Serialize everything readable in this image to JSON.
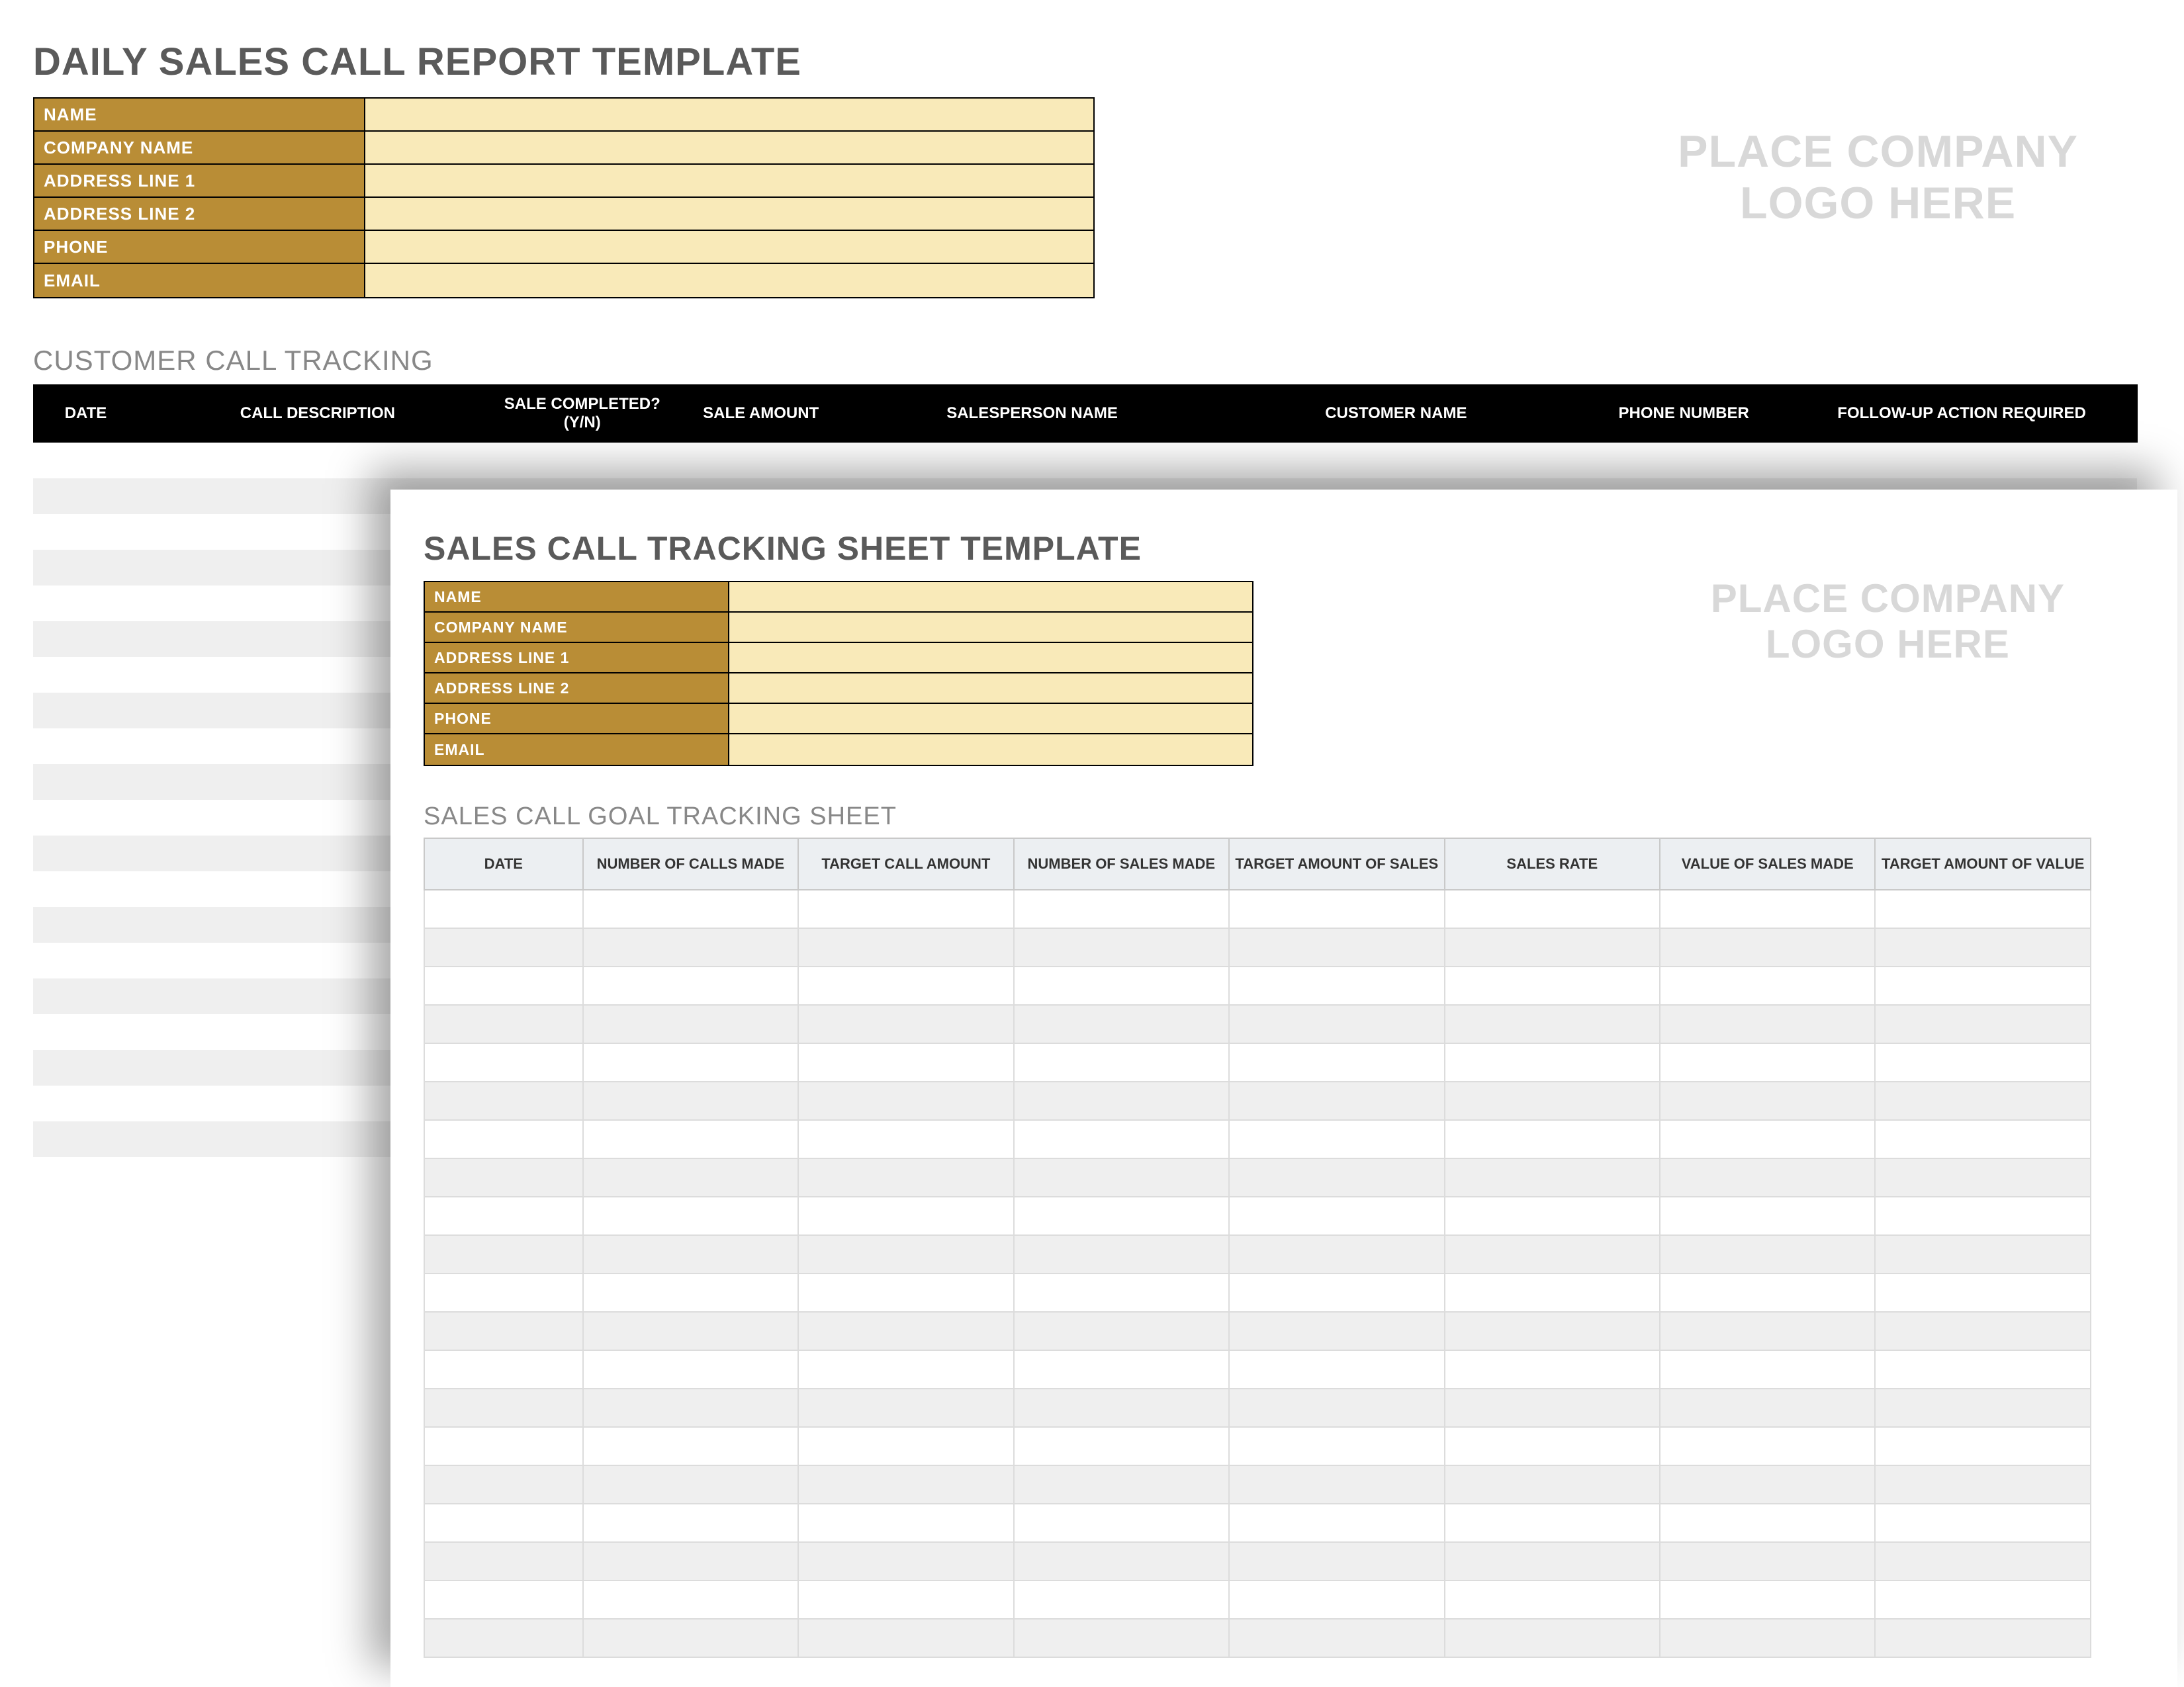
{
  "back": {
    "title": "DAILY SALES CALL REPORT TEMPLATE",
    "info": {
      "name_label": "NAME",
      "company_label": "COMPANY NAME",
      "addr1_label": "ADDRESS LINE 1",
      "addr2_label": "ADDRESS LINE 2",
      "phone_label": "PHONE",
      "email_label": "EMAIL",
      "name": "",
      "company": "",
      "addr1": "",
      "addr2": "",
      "phone": "",
      "email": ""
    },
    "logo_line1": "PLACE COMPANY",
    "logo_line2": "LOGO HERE",
    "section": "CUSTOMER CALL TRACKING",
    "columns": {
      "date": "DATE",
      "desc": "CALL DESCRIPTION",
      "completed": "SALE COMPLETED? (Y/N)",
      "amount": "SALE AMOUNT",
      "salesperson": "SALESPERSON NAME",
      "customer": "CUSTOMER NAME",
      "phone": "PHONE NUMBER",
      "followup": "FOLLOW-UP ACTION REQUIRED"
    },
    "row_count": 20
  },
  "front": {
    "title": "SALES CALL TRACKING SHEET TEMPLATE",
    "info": {
      "name_label": "NAME",
      "company_label": "COMPANY NAME",
      "addr1_label": "ADDRESS LINE 1",
      "addr2_label": "ADDRESS LINE 2",
      "phone_label": "PHONE",
      "email_label": "EMAIL",
      "name": "",
      "company": "",
      "addr1": "",
      "addr2": "",
      "phone": "",
      "email": ""
    },
    "logo_line1": "PLACE COMPANY",
    "logo_line2": "LOGO HERE",
    "section": "SALES CALL GOAL TRACKING SHEET",
    "columns": {
      "date": "DATE",
      "num_calls": "NUMBER OF CALLS MADE",
      "target_call": "TARGET CALL AMOUNT",
      "num_sales": "NUMBER OF SALES MADE",
      "target_sales": "TARGET AMOUNT OF SALES",
      "sales_rate": "SALES RATE",
      "value_sales": "VALUE OF SALES MADE",
      "target_value": "TARGET AMOUNT OF VALUE"
    },
    "row_count": 20
  }
}
